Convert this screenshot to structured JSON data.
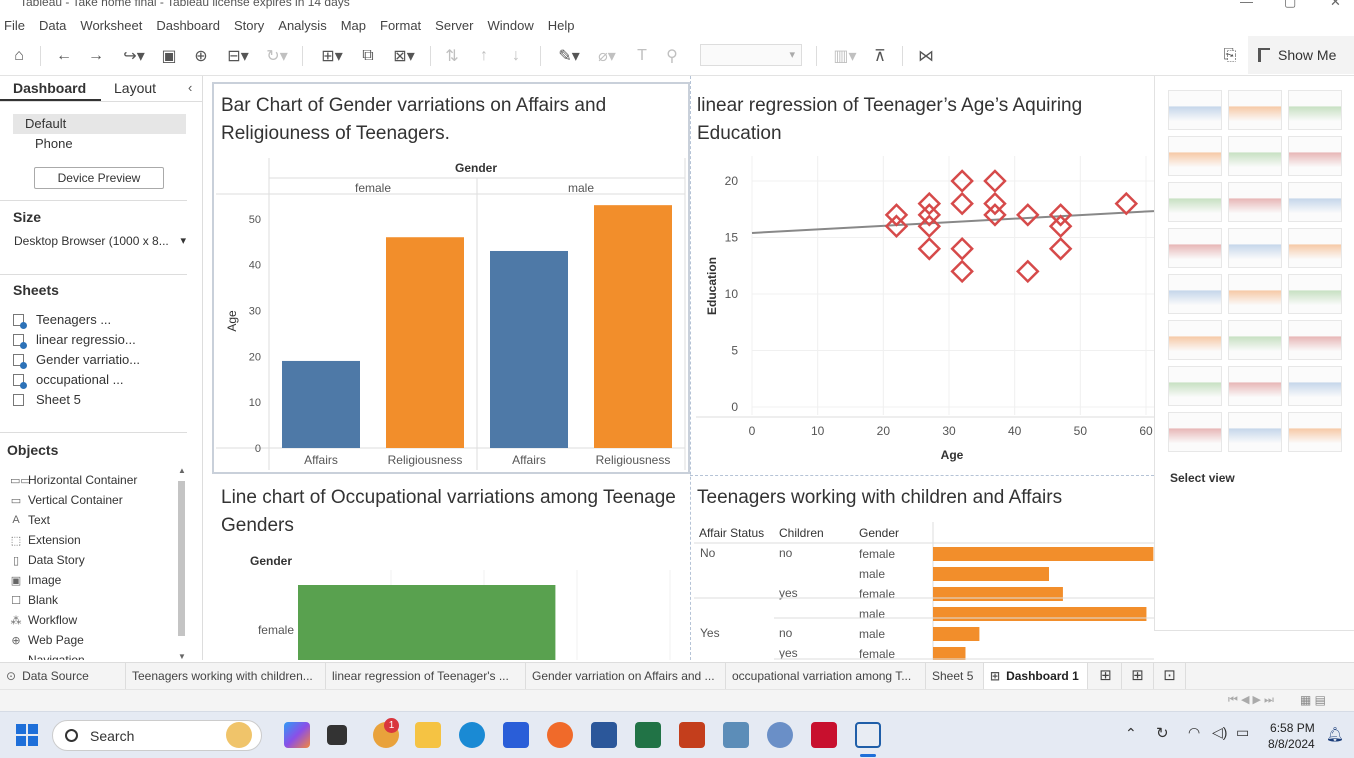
{
  "window": {
    "title": "Tableau - Take home final - Tableau license expires in 14 days"
  },
  "menu": [
    "File",
    "Data",
    "Worksheet",
    "Dashboard",
    "Story",
    "Analysis",
    "Map",
    "Format",
    "Server",
    "Window",
    "Help"
  ],
  "toolbar": {
    "show_me_label": "Show Me"
  },
  "left_pane": {
    "tabs": [
      "Dashboard",
      "Layout"
    ],
    "devices": [
      "Default",
      "Phone"
    ],
    "device_preview_button": "Device Preview",
    "size_heading": "Size",
    "size_value": "Desktop Browser (1000 x 8...",
    "sheets_heading": "Sheets",
    "sheets": [
      "Teenagers ...",
      "linear regressio...",
      "Gender varriatio...",
      "occupational ...",
      "Sheet 5"
    ],
    "objects_heading": "Objects",
    "objects": [
      {
        "label": "Horizontal Container",
        "icon": "horizontal-container-icon",
        "glyph": "▭▭"
      },
      {
        "label": "Vertical Container",
        "icon": "vertical-container-icon",
        "glyph": "▭"
      },
      {
        "label": "Text",
        "icon": "text-icon",
        "glyph": "A"
      },
      {
        "label": "Extension",
        "icon": "extension-icon",
        "glyph": "⬚"
      },
      {
        "label": "Data Story",
        "icon": "data-story-icon",
        "glyph": "▯"
      },
      {
        "label": "Image",
        "icon": "image-icon",
        "glyph": "▣"
      },
      {
        "label": "Blank",
        "icon": "blank-icon",
        "glyph": "☐"
      },
      {
        "label": "Workflow",
        "icon": "workflow-icon",
        "glyph": "⁂"
      },
      {
        "label": "Web Page",
        "icon": "web-page-icon",
        "glyph": "⊕"
      },
      {
        "label": "Navigation",
        "icon": "navigation-icon",
        "glyph": "→"
      }
    ]
  },
  "panels": {
    "bar": {
      "title": "Bar Chart of Gender varriations on Affairs and Religiouness of Teenagers.",
      "header": "Gender",
      "ylabel": "Age"
    },
    "scatter": {
      "title": "linear regression of Teenager’s  Age’s Aquiring Education",
      "xlabel": "Age",
      "ylabel": "Education"
    },
    "line": {
      "title": "Line chart of Occupational varriations among Teenage Genders",
      "row_header": "Gender"
    },
    "table": {
      "title": "Teenagers working with children and Affairs",
      "columns": [
        "Affair Status",
        "Children",
        "Gender"
      ]
    }
  },
  "chart_data": [
    {
      "type": "bar",
      "title": "Bar Chart of Gender varriations on Affairs and Religiouness of Teenagers.",
      "ylabel": "Age",
      "ylim": [
        0,
        55
      ],
      "yticks": [
        0,
        10,
        20,
        30,
        40,
        50
      ],
      "facet_label": "Gender",
      "facets": [
        "female",
        "male"
      ],
      "categories": [
        "Affairs",
        "Religiousness"
      ],
      "values": [
        [
          19,
          46
        ],
        [
          43,
          53
        ]
      ],
      "colors": {
        "Affairs": "#4e79a7",
        "Religiousness": "#f28e2b"
      }
    },
    {
      "type": "scatter",
      "title": "linear regression of Teenager’s  Age’s Aquiring Education",
      "xlabel": "Age",
      "ylabel": "Education",
      "xlim": [
        0,
        60
      ],
      "ylim": [
        0,
        20
      ],
      "xticks": [
        0,
        10,
        20,
        30,
        40,
        50,
        60
      ],
      "yticks": [
        0,
        5,
        10,
        15,
        20
      ],
      "points": [
        [
          22,
          17
        ],
        [
          22,
          16
        ],
        [
          27,
          18
        ],
        [
          27,
          17
        ],
        [
          27,
          16
        ],
        [
          27,
          14
        ],
        [
          32,
          20
        ],
        [
          32,
          18
        ],
        [
          32,
          14
        ],
        [
          32,
          12
        ],
        [
          37,
          20
        ],
        [
          37,
          18
        ],
        [
          37,
          17
        ],
        [
          42,
          17
        ],
        [
          42,
          12
        ],
        [
          47,
          17
        ],
        [
          47,
          16
        ],
        [
          47,
          14
        ],
        [
          57,
          18
        ]
      ],
      "trend": {
        "start": [
          0,
          15.4
        ],
        "end": [
          60,
          17.3
        ]
      },
      "marker_color": "#d64a4a",
      "trend_color": "#888888"
    },
    {
      "type": "bar",
      "title": "Line chart of Occupational varriations among Teenage Genders",
      "categories": [
        "female"
      ],
      "values": [
        0.65
      ],
      "color": "#59a14f"
    },
    {
      "type": "bar",
      "title": "Teenagers working with children and Affairs",
      "rows": [
        {
          "affair": "No",
          "children": "no",
          "gender": "female",
          "value": 0.95
        },
        {
          "affair": "",
          "children": "",
          "gender": "male",
          "value": 0.5
        },
        {
          "affair": "",
          "children": "yes",
          "gender": "female",
          "value": 0.56
        },
        {
          "affair": "",
          "children": "",
          "gender": "male",
          "value": 0.92
        },
        {
          "affair": "Yes",
          "children": "no",
          "gender": "male",
          "value": 0.2
        },
        {
          "affair": "",
          "children": "yes",
          "gender": "female",
          "value": 0.14
        }
      ],
      "color": "#f28e2b"
    }
  ],
  "show_me": {
    "select_view": "Select view"
  },
  "sheet_tabs": [
    "Data Source",
    "Teenagers working with children...",
    "linear regression of Teenager's ...",
    "Gender varriation on Affairs and ...",
    "occupational varriation among T...",
    "Sheet 5",
    "Dashboard 1"
  ],
  "taskbar": {
    "search_placeholder": "Search",
    "time": "6:58 PM",
    "date": "8/8/2024",
    "notification_badge": "1"
  }
}
